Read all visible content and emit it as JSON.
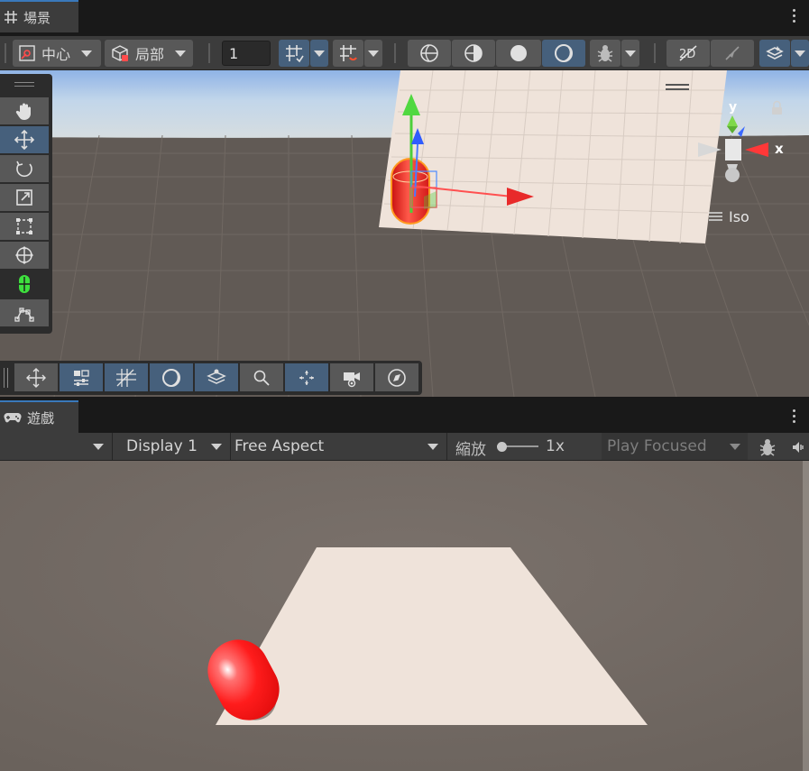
{
  "scene_tab": {
    "title": "場景"
  },
  "scene_toolbar": {
    "pivot_label": "中心",
    "space_label": "局部",
    "grid_size_value": "1"
  },
  "scene_view": {
    "projection_label": "Iso",
    "axis_y": "y",
    "axis_x": "x"
  },
  "game_tab": {
    "title": "遊戲"
  },
  "game_toolbar": {
    "display_label": "Display 1",
    "aspect_label": "Free Aspect",
    "scale_label": "縮放",
    "scale_value": "1x",
    "scale_fraction": 0.0,
    "play_mode_label": "Play Focused"
  },
  "colors": {
    "accent_blue": "#3a79bb",
    "active_button": "#46607c",
    "button": "#585858",
    "capsule_red": "#ff2a2a",
    "plane": "#efe3da"
  },
  "icons": {
    "scene_tab": "grid-icon",
    "game_tab": "gamepad-icon",
    "tools": [
      "hand-icon",
      "move-icon",
      "rotate-icon",
      "scale-icon",
      "rect-icon",
      "transform-icon",
      "custom-tool-icon",
      "path-icon"
    ],
    "overlays": [
      "move-overlay-icon",
      "sliders-icon",
      "grid-snap-icon",
      "shading-icon",
      "layers-icon",
      "search-icon",
      "orientation-icon",
      "camera-icon",
      "compass-icon"
    ]
  }
}
